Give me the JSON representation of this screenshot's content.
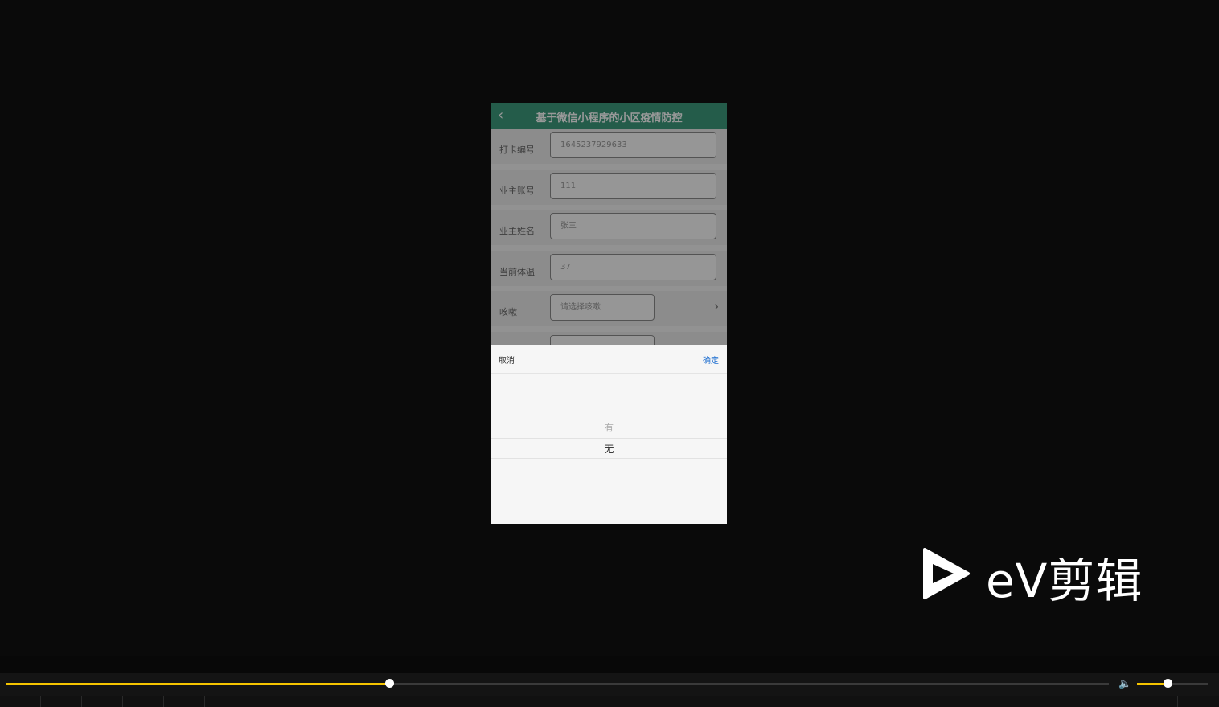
{
  "app": {
    "nav_title": "基于微信小程序的小区疫情防控",
    "back_icon": "chevron-left-icon"
  },
  "form": {
    "rows": [
      {
        "label": "打卡编号",
        "value": "1645237929633"
      },
      {
        "label": "业主账号",
        "value": "111"
      },
      {
        "label": "业主姓名",
        "value": "张三"
      },
      {
        "label": "当前体温",
        "value": "37"
      },
      {
        "label": "咳嗽",
        "placeholder": "请选择咳嗽"
      }
    ]
  },
  "picker": {
    "cancel_label": "取消",
    "confirm_label": "确定",
    "options": [
      "有",
      "无"
    ],
    "selected": "无"
  },
  "watermark": {
    "text": "eV剪辑",
    "icon": "play-logo-icon"
  },
  "player": {
    "progress_fraction": 0.348,
    "volume_fraction": 0.44,
    "volume_icon": "speaker-icon",
    "accent_color": "#f5c400"
  },
  "colors": {
    "nav_bg": "#3d9a7c",
    "confirm_blue": "#1f6fd0",
    "background": "#0a0a0a"
  }
}
